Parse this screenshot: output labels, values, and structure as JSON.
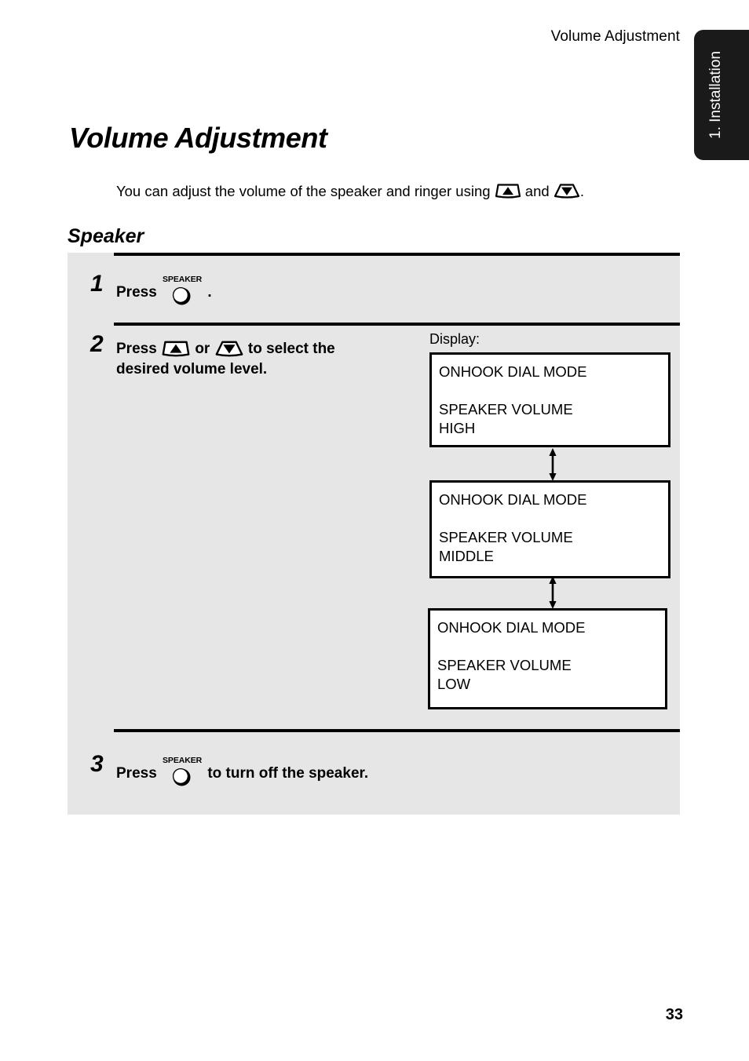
{
  "header": {
    "running_head": "Volume Adjustment"
  },
  "thumb_tab": {
    "label": "1. Installation",
    "color": "#1a1a1a"
  },
  "title": "Volume Adjustment",
  "intro": {
    "text_before": "You can adjust the volume of the speaker and ringer using ",
    "text_middle": " and ",
    "text_after": ".",
    "up_key_icon": "volume-up-key-icon",
    "down_key_icon": "volume-down-key-icon"
  },
  "section_heading": "Speaker",
  "steps": [
    {
      "number": "1",
      "text_before": "Press ",
      "text_after": " .",
      "button_label": "SPEAKER"
    },
    {
      "number": "2",
      "line1_before": "Press ",
      "line1_middle": " or ",
      "line1_after": " to select the",
      "line2": "desired volume level."
    },
    {
      "number": "3",
      "text_before": "Press ",
      "text_after": " to turn off the speaker.",
      "button_label": "SPEAKER"
    }
  ],
  "display": {
    "label": "Display:",
    "screens": [
      {
        "name": "speaker-volume-high",
        "lines": "ONHOOK DIAL MODE\n\nSPEAKER VOLUME\nHIGH"
      },
      {
        "name": "speaker-volume-middle",
        "lines": "ONHOOK DIAL MODE\n\nSPEAKER VOLUME\nMIDDLE"
      },
      {
        "name": "speaker-volume-low",
        "lines": "ONHOOK DIAL MODE\n\nSPEAKER VOLUME\nLOW"
      }
    ]
  },
  "page_number": "33"
}
